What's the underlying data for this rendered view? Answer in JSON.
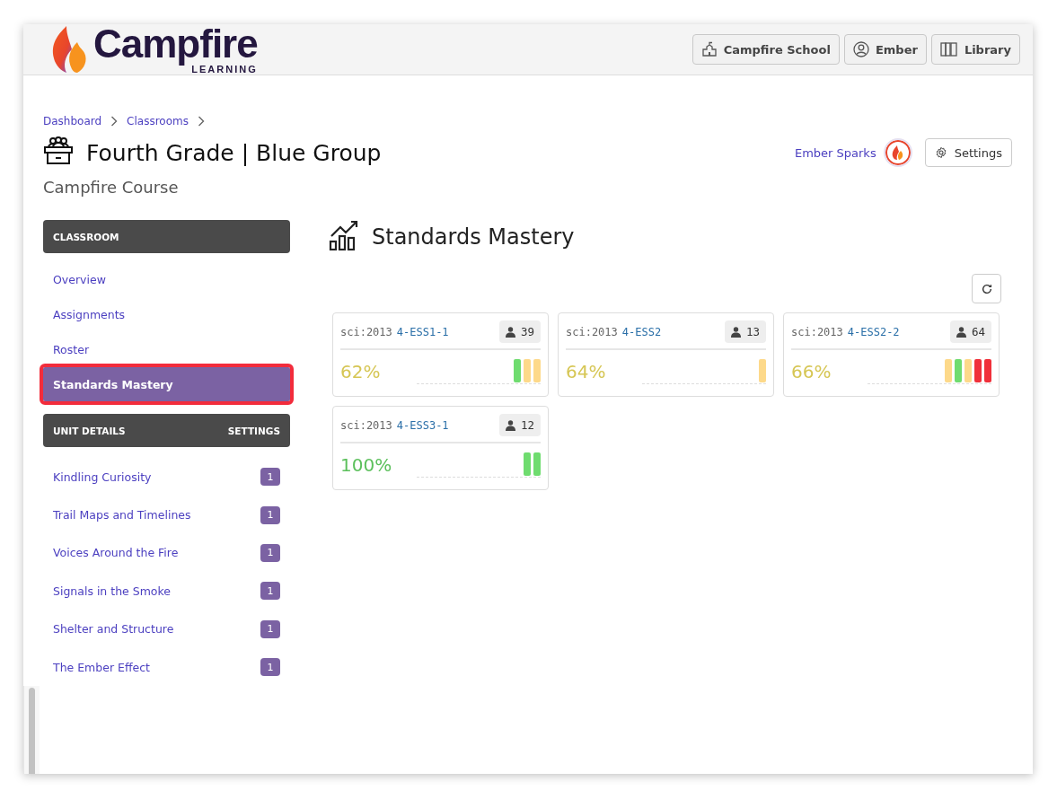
{
  "header": {
    "logo": {
      "name": "Campfire",
      "tagline": "LEARNING"
    },
    "buttons": [
      {
        "kind": "school",
        "label": "Campfire School"
      },
      {
        "kind": "user",
        "label": "Ember"
      },
      {
        "kind": "library",
        "label": "Library"
      }
    ]
  },
  "breadcrumb": [
    "Dashboard",
    "Classrooms"
  ],
  "page": {
    "title": "Fourth Grade | Blue Group",
    "subtitle": "Campfire Course",
    "user": "Ember Sparks",
    "settings": "Settings"
  },
  "sidebar": {
    "sections": [
      {
        "title": "CLASSROOM",
        "items": [
          {
            "label": "Overview",
            "selected": false
          },
          {
            "label": "Assignments",
            "selected": false
          },
          {
            "label": "Roster",
            "selected": false
          },
          {
            "label": "Standards Mastery",
            "selected": true
          }
        ]
      },
      {
        "title": "UNIT DETAILS",
        "action": "SETTINGS",
        "items": [
          {
            "label": "Kindling Curiosity",
            "count": "1",
            "selected": false
          },
          {
            "label": "Trail Maps and Timelines",
            "count": "1",
            "selected": false
          },
          {
            "label": "Voices Around the Fire",
            "count": "1",
            "selected": false
          },
          {
            "label": "Signals in the Smoke",
            "count": "1",
            "selected": false
          },
          {
            "label": "Shelter and Structure",
            "count": "1",
            "selected": false
          },
          {
            "label": "The Ember Effect",
            "count": "1",
            "selected": false
          }
        ]
      }
    ]
  },
  "main": {
    "title": "Standards Mastery",
    "cards": [
      {
        "prefix": "sci:2013",
        "code": "4-ESS1-1",
        "students": "39",
        "percent": "62%",
        "color": "#d6c654",
        "bars": [
          {
            "color": "#6fdc6f"
          },
          {
            "color": "#fdd98a"
          },
          {
            "color": "#fdd98a"
          }
        ]
      },
      {
        "prefix": "sci:2013",
        "code": "4-ESS2",
        "students": "13",
        "percent": "64%",
        "color": "#d6c654",
        "bars": [
          {
            "color": "#fdd98a"
          }
        ]
      },
      {
        "prefix": "sci:2013",
        "code": "4-ESS2-2",
        "students": "64",
        "percent": "66%",
        "color": "#d6c654",
        "bars": [
          {
            "color": "#fdd98a"
          },
          {
            "color": "#6fdc6f"
          },
          {
            "color": "#fdd98a"
          },
          {
            "color": "#f0303a"
          },
          {
            "color": "#f0303a"
          }
        ]
      },
      {
        "prefix": "sci:2013",
        "code": "4-ESS3-1",
        "students": "12",
        "percent": "100%",
        "color": "#5cc05c",
        "bars": [
          {
            "color": "#6fdc6f"
          },
          {
            "color": "#6fdc6f"
          }
        ]
      }
    ]
  }
}
